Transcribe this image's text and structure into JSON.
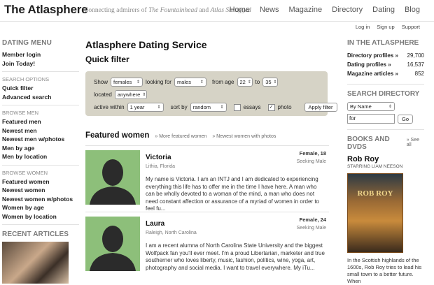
{
  "header": {
    "logo": "The Atlasphere",
    "tagline_prefix": "Connecting admirers of ",
    "tagline_book1": "The Fountainhead",
    "tagline_mid": " and ",
    "tagline_book2": "Atlas Shrugged",
    "nav": [
      "Home",
      "News",
      "Magazine",
      "Directory",
      "Dating",
      "Blog"
    ],
    "subnav": [
      "Log in",
      "Sign up",
      "Support"
    ]
  },
  "left": {
    "title": "Dating Menu",
    "top_items": [
      "Member login",
      "Join Today!"
    ],
    "search_options_label": "Search Options",
    "search_items": [
      "Quick filter",
      "Advanced search"
    ],
    "browse_men_label": "Browse Men",
    "men_items": [
      "Featured men",
      "Newest men",
      "Newest men w/photos",
      "Men by age",
      "Men by location"
    ],
    "browse_women_label": "Browse Women",
    "women_items": [
      "Featured women",
      "Newest women",
      "Newest women w/photos",
      "Women by age",
      "Women by location"
    ],
    "recent_articles": "Recent Articles"
  },
  "main": {
    "title": "Atlasphere Dating Service",
    "subtitle": "Quick filter",
    "filter": {
      "show_label": "Show",
      "show_value": "females",
      "looking_label": "looking for",
      "looking_value": "males",
      "age_label": "from age",
      "age_from": "22",
      "to_label": "to",
      "age_to": "35",
      "located_label": "located",
      "located_value": "anywhere",
      "active_label": "active within",
      "active_value": "1 year",
      "sort_label": "sort by",
      "sort_value": "random",
      "essays_label": "essays",
      "photo_label": "photo",
      "apply_label": "Apply filter"
    },
    "featured_title": "Featured women",
    "more_link": "» More featured women",
    "newest_link": "» Newest women with photos",
    "profiles": [
      {
        "name": "Victoria",
        "location": "Lithia, Florida",
        "gender_age": "Female, 18",
        "seeking": "Seeking Male",
        "desc": "My name is Victoria. I am an INTJ and I am dedicated to experiencing everything this life has to offer me in the time I have here. A man who can be wholly devoted to a woman of the mind, a man who does not need constant affection or assurance of a myriad of women in order to feel fu..."
      },
      {
        "name": "Laura",
        "location": "Raleigh, North Carolina",
        "gender_age": "Female, 24",
        "seeking": "Seeking Male",
        "desc": "I am a recent alumna of North Carolina State University and the biggest Wolfpack fan you'll ever meet. I'm a proud Libertarian, marketer and true southerner who loves liberty, music, fashion, politics, wine, yoga, art, photography and social media. I want to travel everywhere. My iTu..."
      }
    ]
  },
  "right": {
    "title": "In the Atlasphere",
    "stats": [
      {
        "label": "Directory profiles »",
        "value": "29,700"
      },
      {
        "label": "Dating profiles »",
        "value": "16,537"
      },
      {
        "label": "Magazine articles »",
        "value": "852"
      }
    ],
    "search_title": "Search Directory",
    "search_select": "By Name",
    "search_value": "for",
    "go_label": "Go",
    "books_title": "Books and DVDs",
    "see_all": "» See all",
    "book_title": "Rob Roy",
    "book_sub": "Starring Liam Neeson",
    "poster_text": "ROB ROY",
    "book_desc": "In the Scottish highlands of the 1600s, Rob Roy tries to lead his small town to a better future. When"
  }
}
